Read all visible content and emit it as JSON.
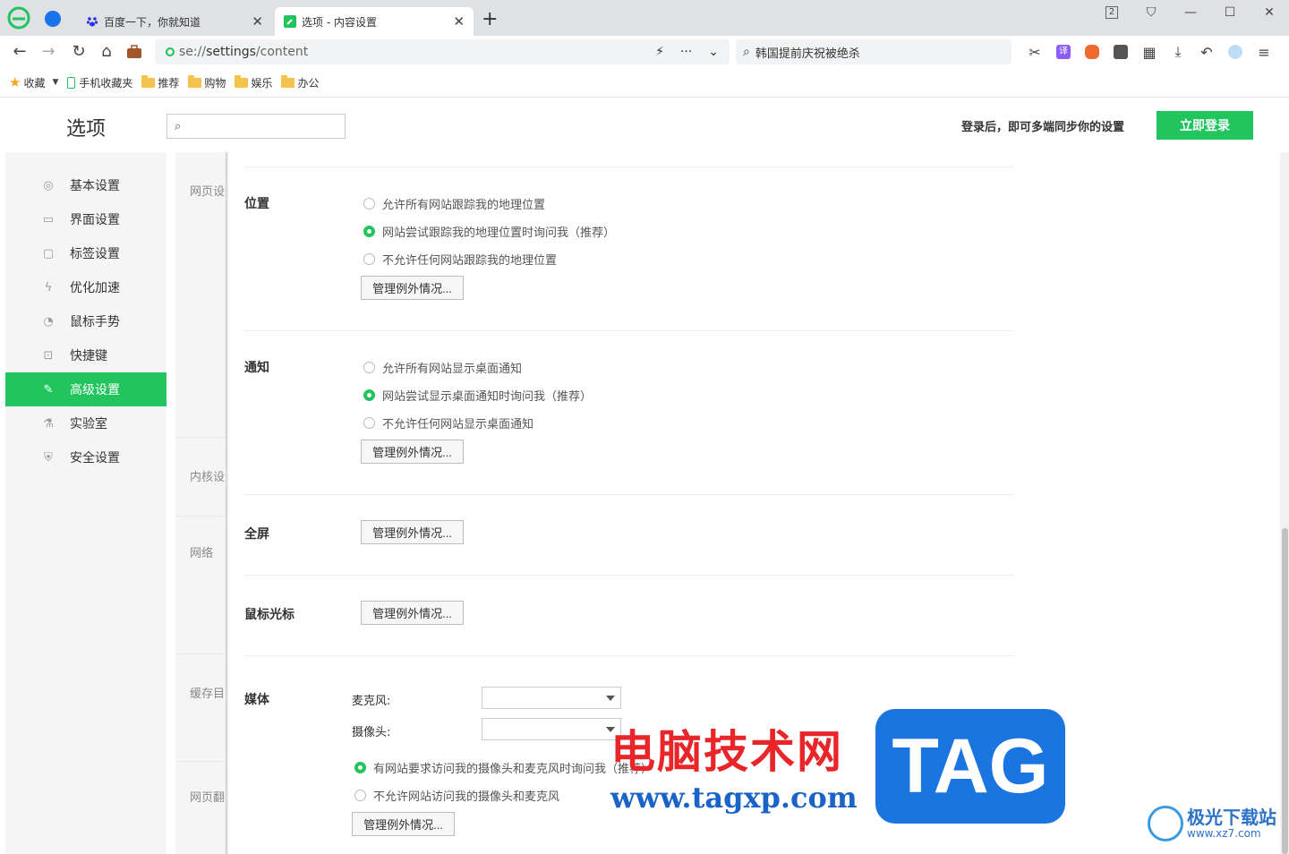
{
  "browser": {
    "tabs": [
      {
        "title": "百度一下，你就知道",
        "icon": "baidu-paw-icon",
        "active": false
      },
      {
        "title": "选项 - 内容设置",
        "icon": "settings-wrench-icon",
        "active": true
      }
    ],
    "new_tab": "+",
    "window_count": "2",
    "address": {
      "scheme": "se://",
      "host": "settings",
      "path": "/content"
    },
    "search_query": "韩国提前庆祝被绝杀",
    "bookmarks": [
      {
        "label": "收藏",
        "icon": "star-icon"
      },
      {
        "label": "手机收藏夹",
        "icon": "phone-icon"
      },
      {
        "label": "推荐",
        "icon": "folder-icon"
      },
      {
        "label": "购物",
        "icon": "folder-icon"
      },
      {
        "label": "娱乐",
        "icon": "folder-icon"
      },
      {
        "label": "办公",
        "icon": "folder-icon"
      }
    ]
  },
  "header": {
    "title": "选项",
    "search_placeholder": "",
    "login_hint": "登录后，即可多端同步你的设置",
    "login_button": "立即登录"
  },
  "sidebar": {
    "items": [
      {
        "label": "基本设置",
        "icon": "gear-icon"
      },
      {
        "label": "界面设置",
        "icon": "window-icon"
      },
      {
        "label": "标签设置",
        "icon": "tag-icon"
      },
      {
        "label": "优化加速",
        "icon": "lightning-icon"
      },
      {
        "label": "鼠标手势",
        "icon": "mouse-icon"
      },
      {
        "label": "快捷键",
        "icon": "keyboard-icon"
      },
      {
        "label": "高级设置",
        "icon": "wrench-icon",
        "active": true
      },
      {
        "label": "实验室",
        "icon": "flask-icon"
      },
      {
        "label": "安全设置",
        "icon": "shield-icon"
      }
    ]
  },
  "categories": [
    "网页设",
    "内核设",
    "网络",
    "缓存目",
    "网页翻"
  ],
  "sections": {
    "location": {
      "label": "位置",
      "options": [
        "允许所有网站跟踪我的地理位置",
        "网站尝试跟踪我的地理位置时询问我（推荐）",
        "不允许任何网站跟踪我的地理位置"
      ],
      "selected": 1,
      "button": "管理例外情况..."
    },
    "notify": {
      "label": "通知",
      "options": [
        "允许所有网站显示桌面通知",
        "网站尝试显示桌面通知时询问我（推荐）",
        "不允许任何网站显示桌面通知"
      ],
      "selected": 1,
      "button": "管理例外情况..."
    },
    "fullscreen": {
      "label": "全屏",
      "button": "管理例外情况..."
    },
    "cursor": {
      "label": "鼠标光标",
      "button": "管理例外情况..."
    },
    "media": {
      "label": "媒体",
      "mic_label": "麦克风:",
      "mic_value": "",
      "camera_label": "摄像头:",
      "camera_value": "",
      "options": [
        "有网站要求访问我的摄像头和麦克风时询问我（推荐）",
        "不允许网站访问我的摄像头和麦克风"
      ],
      "selected": 0,
      "button": "管理例外情况..."
    }
  },
  "watermark": {
    "cn": "电脑技术网",
    "url": "www.tagxp.com",
    "tag": "TAG",
    "site_cn": "极光下载站",
    "site_url": "www.xz7.com"
  },
  "colors": {
    "accent": "#22c45e",
    "tab_bg": "#dfe1e5"
  }
}
